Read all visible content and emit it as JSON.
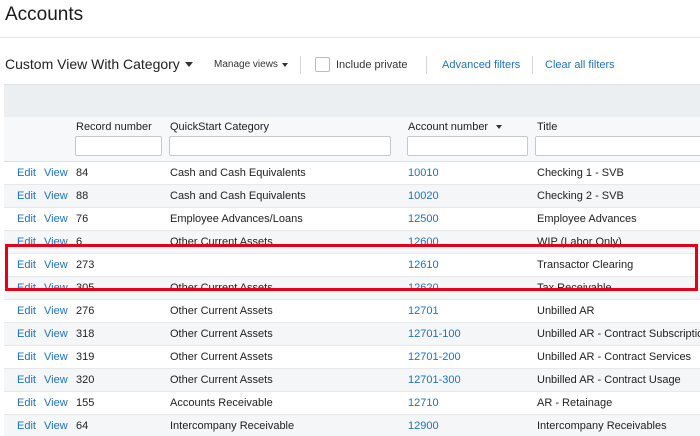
{
  "page": {
    "title": "Accounts"
  },
  "toolbar": {
    "view_name": "Custom View With Category",
    "manage_views": "Manage views",
    "include_private": "Include private",
    "advanced_filters": "Advanced filters",
    "clear_all_filters": "Clear all filters"
  },
  "table": {
    "columns": {
      "record_number": "Record number",
      "quickstart_category": "QuickStart Category",
      "account_number": "Account number",
      "title": "Title"
    },
    "edit_label": "Edit",
    "view_label": "View",
    "rows": [
      {
        "record": "84",
        "category": "Cash and Cash Equivalents",
        "account": "10010",
        "title": "Checking 1 - SVB"
      },
      {
        "record": "88",
        "category": "Cash and Cash Equivalents",
        "account": "10020",
        "title": "Checking 2 - SVB"
      },
      {
        "record": "76",
        "category": "Employee Advances/Loans",
        "account": "12500",
        "title": "Employee Advances"
      },
      {
        "record": "6",
        "category": "Other Current Assets",
        "account": "12600",
        "title": "WIP (Labor Only)"
      },
      {
        "record": "273",
        "category": "",
        "account": "12610",
        "title": "Transactor Clearing"
      },
      {
        "record": "305",
        "category": "Other Current Assets",
        "account": "12620",
        "title": "Tax Receivable"
      },
      {
        "record": "276",
        "category": "Other Current Assets",
        "account": "12701",
        "title": "Unbilled AR"
      },
      {
        "record": "318",
        "category": "Other Current Assets",
        "account": "12701-100",
        "title": "Unbilled AR - Contract Subscriptio"
      },
      {
        "record": "319",
        "category": "Other Current Assets",
        "account": "12701-200",
        "title": "Unbilled AR - Contract Services"
      },
      {
        "record": "320",
        "category": "Other Current Assets",
        "account": "12701-300",
        "title": "Unbilled AR - Contract Usage"
      },
      {
        "record": "155",
        "category": "Accounts Receivable",
        "account": "12710",
        "title": "AR - Retainage"
      },
      {
        "record": "64",
        "category": "Intercompany Receivable",
        "account": "12900",
        "title": "Intercompany Receivables"
      }
    ]
  },
  "annotation": {
    "highlight_color": "#e2001a"
  }
}
